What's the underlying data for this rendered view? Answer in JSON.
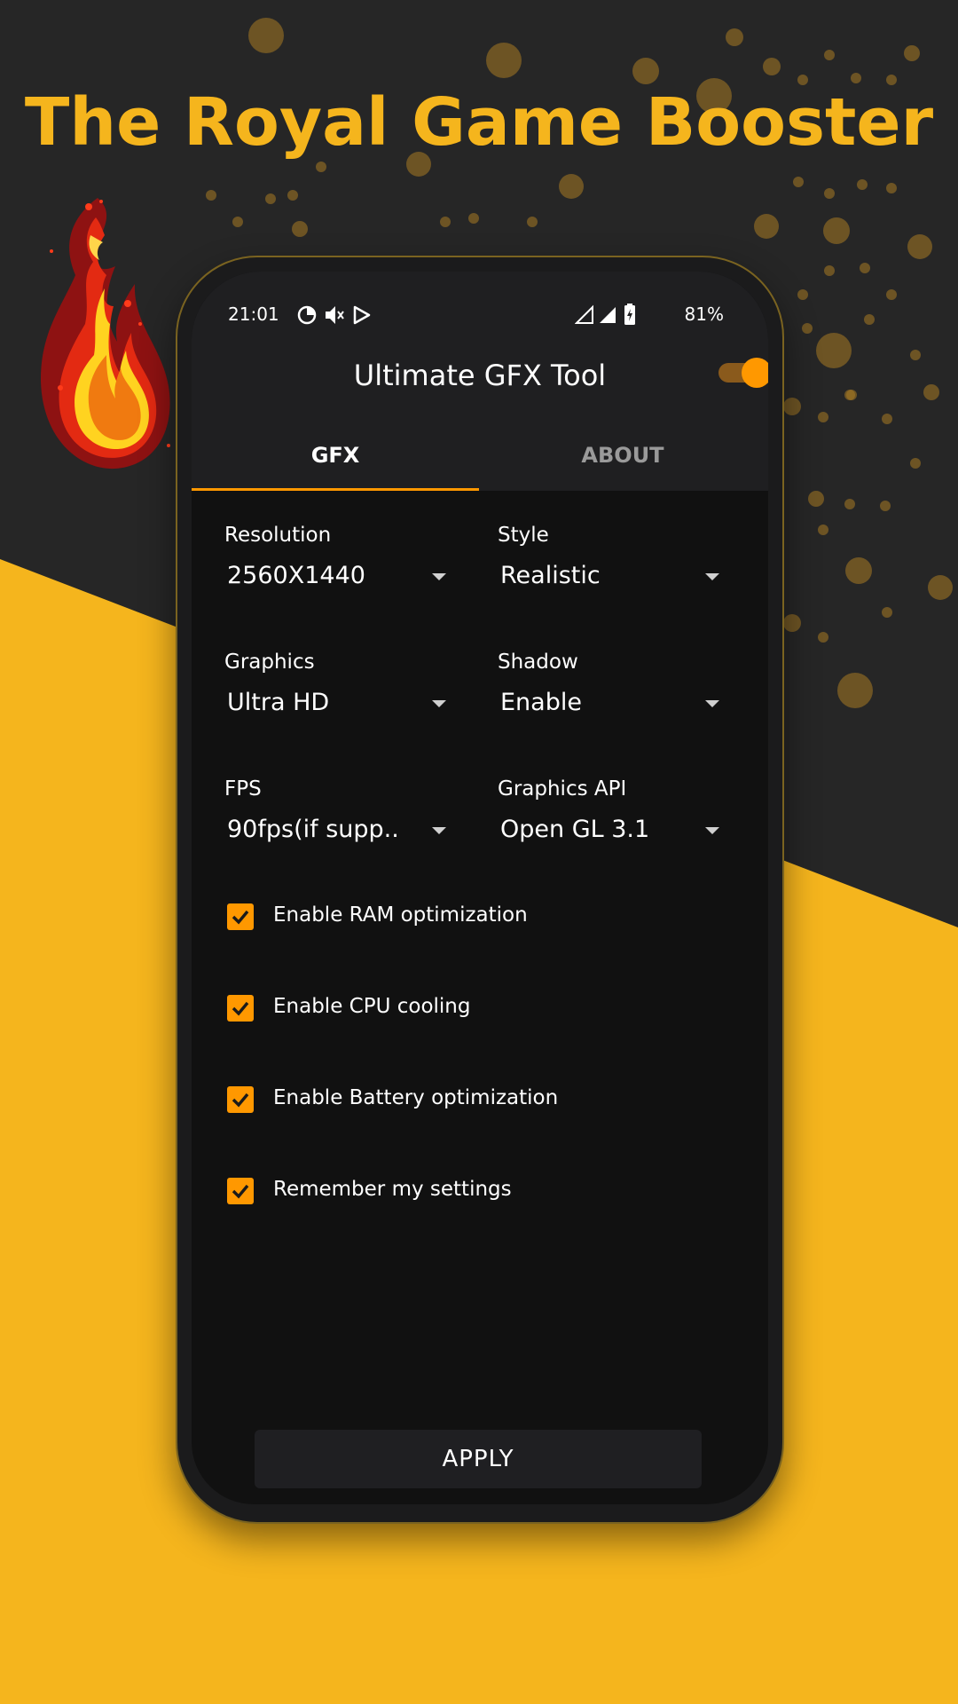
{
  "colors": {
    "background_dark": "#262626",
    "background_yellow": "#f5b51d",
    "accent_orange": "#ff9800",
    "headline": "#f5b51d",
    "screen": "#111111"
  },
  "promo": {
    "headline": "The Royal Game Booster"
  },
  "statusbar": {
    "time": "21:01",
    "battery": "81%",
    "icons_left": [
      "data-saver-icon",
      "mute-icon",
      "play-store-icon"
    ],
    "icons_right": [
      "signal-empty-icon",
      "signal-icon",
      "battery-charging-icon"
    ]
  },
  "app": {
    "title": "Ultimate GFX Tool",
    "power_toggle_on": true
  },
  "tabs": [
    {
      "label": "GFX",
      "active": true
    },
    {
      "label": "ABOUT",
      "active": false
    }
  ],
  "settings": {
    "resolution": {
      "label": "Resolution",
      "value": "2560X1440"
    },
    "style": {
      "label": "Style",
      "value": "Realistic"
    },
    "graphics": {
      "label": "Graphics",
      "value": "Ultra HD"
    },
    "shadow": {
      "label": "Shadow",
      "value": "Enable"
    },
    "fps": {
      "label": "FPS",
      "value": "90fps(if supp.."
    },
    "graphics_api": {
      "label": "Graphics API",
      "value": "Open GL 3.1"
    }
  },
  "options": [
    {
      "label": "Enable RAM optimization",
      "checked": true
    },
    {
      "label": "Enable CPU cooling",
      "checked": true
    },
    {
      "label": "Enable Battery optimization",
      "checked": true
    },
    {
      "label": "Remember my settings",
      "checked": true
    }
  ],
  "apply_label": "APPLY"
}
